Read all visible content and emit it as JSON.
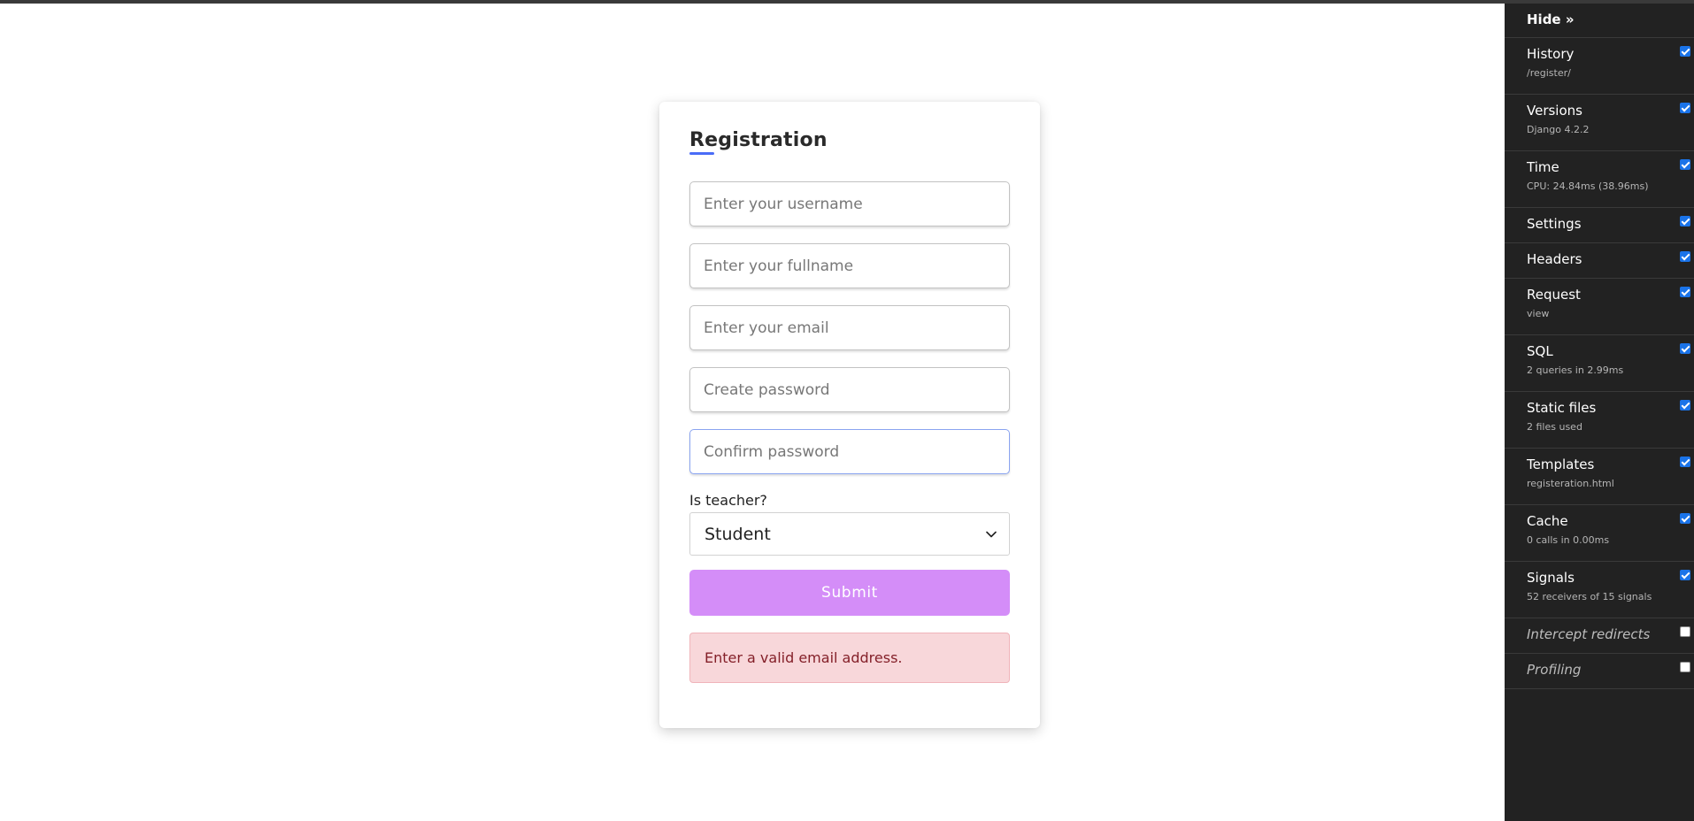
{
  "form": {
    "title": "Registration",
    "fields": [
      {
        "placeholder": "Enter your username",
        "value": ""
      },
      {
        "placeholder": "Enter your fullname",
        "value": ""
      },
      {
        "placeholder": "Enter your email",
        "value": ""
      },
      {
        "placeholder": "Create password",
        "value": ""
      },
      {
        "placeholder": "Confirm password",
        "value": ""
      }
    ],
    "teacher_label": "Is teacher?",
    "teacher_selected": "Student",
    "submit_label": "Submit",
    "error_message": "Enter a valid email address."
  },
  "toolbar": {
    "hide_label": "Hide »",
    "panels": [
      {
        "name": "History",
        "sub": "/register/",
        "checked": true
      },
      {
        "name": "Versions",
        "sub": "Django 4.2.2",
        "checked": true
      },
      {
        "name": "Time",
        "sub": "CPU: 24.84ms (38.96ms)",
        "checked": true
      },
      {
        "name": "Settings",
        "sub": "",
        "checked": true
      },
      {
        "name": "Headers",
        "sub": "",
        "checked": true
      },
      {
        "name": "Request",
        "sub": "view",
        "checked": true
      },
      {
        "name": "SQL",
        "sub": "2 queries in 2.99ms",
        "checked": true
      },
      {
        "name": "Static files",
        "sub": "2 files used",
        "checked": true
      },
      {
        "name": "Templates",
        "sub": "registeration.html",
        "checked": true
      },
      {
        "name": "Cache",
        "sub": "0 calls in 0.00ms",
        "checked": true
      },
      {
        "name": "Signals",
        "sub": "52 receivers of 15 signals",
        "checked": true
      },
      {
        "name": "Intercept redirects",
        "sub": "",
        "checked": false
      },
      {
        "name": "Profiling",
        "sub": "",
        "checked": false
      }
    ]
  },
  "colors": {
    "accent": "#4a6cf7",
    "submit": "#d48df8",
    "alert_bg": "#f8d7da",
    "alert_text": "#842029",
    "toolbar_bg": "#222222",
    "checkbox": "#1a73e8"
  }
}
